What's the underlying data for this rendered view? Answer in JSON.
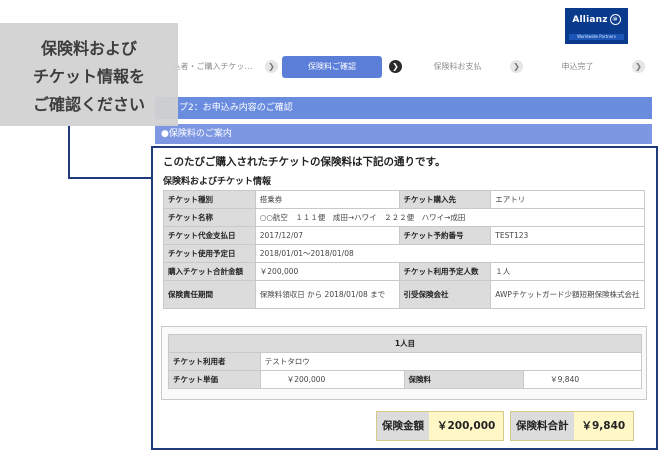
{
  "logo": {
    "brand": "Allianz",
    "brand_mark": "⑩",
    "tagline": "Worldwide Partners"
  },
  "steps": [
    {
      "label": "込者・ご購入チケッ…",
      "state": "done"
    },
    {
      "label": "保険料ご確認",
      "state": "active"
    },
    {
      "label": "保険料お支払",
      "state": "pending"
    },
    {
      "label": "申込完了",
      "state": "pending"
    }
  ],
  "arrow_glyph": "❯",
  "callout": {
    "line1": "保険料および",
    "line2": "チケット情報を",
    "line3": "ご確認ください"
  },
  "header1": "テップ2：お申込み内容のご確認",
  "header2": "●保険料のご案内",
  "intro": "このたびご購入されたチケットの保険料は下記の通りです。",
  "section_title": "保険料およびチケット情報",
  "ticket": {
    "type_label": "チケット種別",
    "type_value": "搭乗券",
    "buyer_label": "チケット購入先",
    "buyer_value": "エアトリ",
    "name_label": "チケット名称",
    "name_value": "○○航空　１１１便　成田→ハワイ　２２２便　ハワイ→成田",
    "paydate_label": "チケット代金支払日",
    "paydate_value": "2017/12/07",
    "resno_label": "チケット予約番号",
    "resno_value": "TEST123",
    "usedate_label": "チケット使用予定日",
    "usedate_value": "2018/01/01～2018/01/08",
    "total_label": "購入チケット合計金額",
    "total_value": "￥200,000",
    "persons_label": "チケット利用予定人数",
    "persons_value": "１人",
    "period_label": "保険責任期間",
    "period_value": "保険料領収日 から 2018/01/08 まで",
    "insurer_label": "引受保険会社",
    "insurer_value": "AWPチケットガード少額短期保険株式会社"
  },
  "person": {
    "heading": "1人目",
    "user_label": "チケット利用者",
    "user_value": "テストタロウ",
    "price_label": "チケット単価",
    "price_value": "￥200,000",
    "premium_label": "保険料",
    "premium_value": "￥9,840"
  },
  "totals": {
    "insured_label": "保険金額",
    "insured_value": "￥200,000",
    "premium_label": "保険料合計",
    "premium_value": "￥9,840"
  }
}
